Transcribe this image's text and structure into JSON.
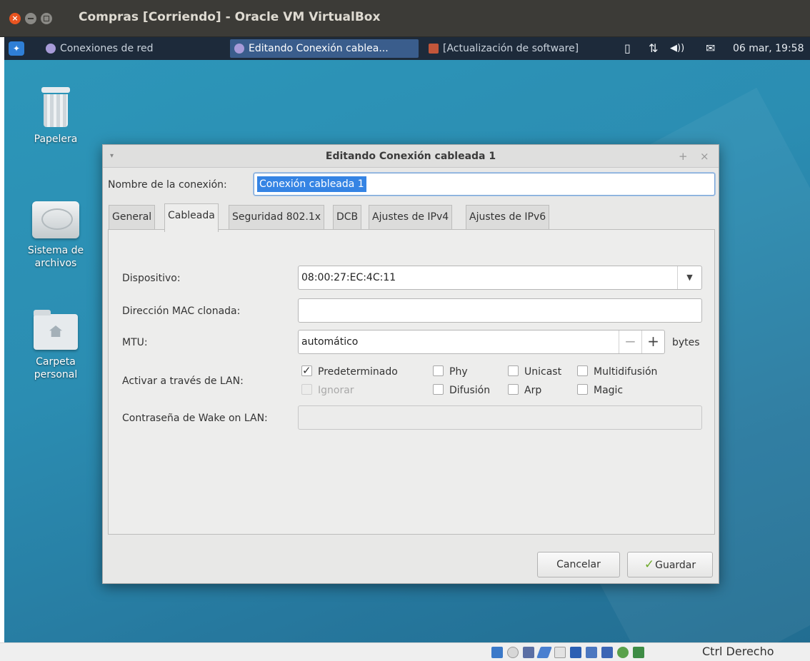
{
  "host_window": {
    "title": "Compras [Corriendo] - Oracle VM VirtualBox",
    "close_glyph": "×"
  },
  "panel": {
    "tasks": [
      {
        "label": "Conexiones de red",
        "icon": "network-icon"
      },
      {
        "label": "Editando Conexión cablea...",
        "icon": "network-icon"
      },
      {
        "label": "[Actualización de software]",
        "icon": "software-update-icon"
      }
    ],
    "tray": {
      "battery": "▯",
      "network": "⇅",
      "volume": "◀))",
      "mail": "✉"
    },
    "clock": "06 mar, 19:58"
  },
  "desktop": {
    "icons": [
      {
        "label": "Papelera"
      },
      {
        "label_line1": "Sistema de",
        "label_line2": "archivos"
      },
      {
        "label_line1": "Carpeta",
        "label_line2": "personal"
      }
    ]
  },
  "dialog": {
    "title": "Editando Conexión cableada 1",
    "menu_glyph": "▾",
    "maximize_glyph": "+",
    "close_glyph": "×",
    "connection_name_label": "Nombre de la conexión:",
    "connection_name_value": "Conexión cableada 1",
    "tabs": [
      "General",
      "Cableada",
      "Seguridad 802.1x",
      "DCB",
      "Ajustes de IPv4",
      "Ajustes de IPv6"
    ],
    "active_tab": "Cableada",
    "wired": {
      "device_label": "Dispositivo:",
      "device_value": "08:00:27:EC:4C:11",
      "dropdown_glyph": "▼",
      "cloned_mac_label": "Dirección MAC clonada:",
      "cloned_mac_value": "",
      "mtu_label": "MTU:",
      "mtu_value": "automático",
      "mtu_minus": "−",
      "mtu_plus": "+",
      "mtu_unit": "bytes",
      "wol_label": "Activar a través de LAN:",
      "wol_options": [
        {
          "label": "Predeterminado",
          "checked": true,
          "disabled": false
        },
        {
          "label": "Phy",
          "checked": false,
          "disabled": false
        },
        {
          "label": "Unicast",
          "checked": false,
          "disabled": false
        },
        {
          "label": "Multidifusión",
          "checked": false,
          "disabled": false
        },
        {
          "label": "Ignorar",
          "checked": false,
          "disabled": true
        },
        {
          "label": "Difusión",
          "checked": false,
          "disabled": false
        },
        {
          "label": "Arp",
          "checked": false,
          "disabled": false
        },
        {
          "label": "Magic",
          "checked": false,
          "disabled": false
        }
      ],
      "wol_password_label": "Contraseña de Wake on LAN:",
      "wol_password_value": ""
    },
    "buttons": {
      "cancel": "Cancelar",
      "save": "Guardar",
      "save_icon": "✓"
    }
  },
  "statusbar": {
    "host_key": "Ctrl Derecho",
    "icons": [
      "hard-disk-icon",
      "optical-drive-icon",
      "audio-icon",
      "usb-icon",
      "shared-folder-icon",
      "display-icon",
      "network-adapter-icon",
      "capture-icon",
      "mouse-integration-icon",
      "keyboard-icon"
    ]
  },
  "colors": {
    "accent_selection": "#3584e4",
    "desktop": "#2b8db2",
    "panel": "#1d2a3a",
    "host_titlebar": "#3c3b37"
  }
}
